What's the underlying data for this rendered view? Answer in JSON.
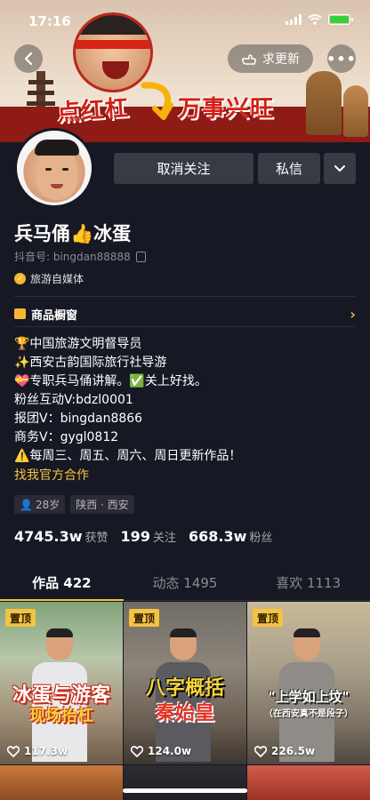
{
  "status_bar": {
    "time": "17:16"
  },
  "banner": {
    "slogan_left": "点红杠",
    "slogan_right": "万事兴旺"
  },
  "header": {
    "request_update_label": "求更新",
    "more_label": "•••"
  },
  "actions": {
    "unfollow_label": "取消关注",
    "message_label": "私信"
  },
  "profile": {
    "name": "兵马俑👍冰蛋",
    "douyin_id": "抖音号: bingdan88888",
    "verification": "旅游自媒体",
    "shop_label": "商品橱窗",
    "bio": [
      "🏆中国旅游文明督导员",
      "✨西安古韵国际旅行社导游",
      "💝专职兵马俑讲解。✅关上好找。",
      "粉丝互动V:bdzl0001",
      "报团V：bingdan8866",
      "商务V：gygl0812",
      "⚠️每周三、周五、周六、周日更新作品！"
    ],
    "business_link": "找我官方合作",
    "tags": [
      "28岁",
      "陕西 · 西安"
    ]
  },
  "stats": [
    {
      "value": "4745.3w",
      "label": "获赞"
    },
    {
      "value": "199",
      "label": "关注"
    },
    {
      "value": "668.3w",
      "label": "粉丝"
    }
  ],
  "tabs": [
    {
      "label": "作品 422",
      "active": true
    },
    {
      "label": "动态 1495",
      "active": false
    },
    {
      "label": "喜欢 1113",
      "active": false
    }
  ],
  "videos": [
    {
      "pinned_label": "置顶",
      "caption_main": "冰蛋与游客",
      "caption_sub": "现场抬杠",
      "likes": "117.3w"
    },
    {
      "pinned_label": "置顶",
      "caption_main": "八字概括",
      "caption_sub": "秦始皇",
      "likes": "124.0w"
    },
    {
      "pinned_label": "置顶",
      "caption_main": "\"上学如上坟\"",
      "caption_sub": "（在西安真不是段子）",
      "likes": "226.5w"
    }
  ],
  "colors": {
    "background": "#161823",
    "accent": "#f5c343",
    "button": "#393b44"
  }
}
